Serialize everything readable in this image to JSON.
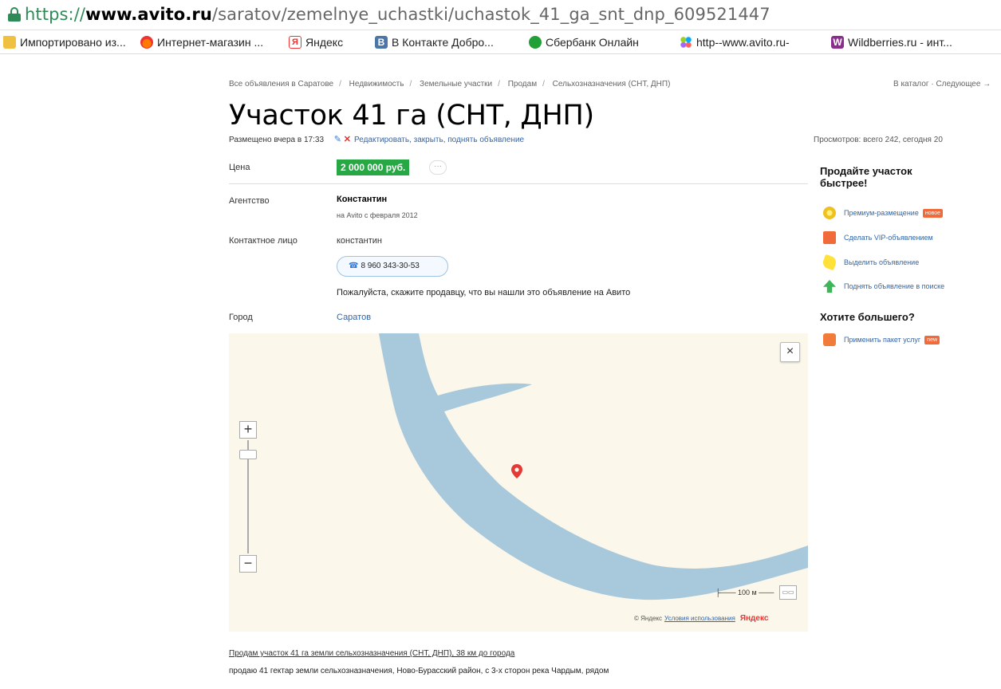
{
  "browser": {
    "url_scheme": "https://",
    "url_host": "www.avito.ru",
    "url_path": "/saratov/zemelnye_uchastki/uchastok_41_ga_snt_dnp_609521447",
    "bookmarks": [
      {
        "label": "Импортировано из...",
        "icon": "folder-icon"
      },
      {
        "label": "Интернет-магазин ...",
        "icon": "fire-icon"
      },
      {
        "label": "Яндекс",
        "icon": "yandex-icon"
      },
      {
        "label": "В Контакте  Добро...",
        "icon": "vk-icon"
      },
      {
        "label": "Сбербанк Онлайн",
        "icon": "sber-icon"
      },
      {
        "label": "http--www.avito.ru-",
        "icon": "avito-icon"
      },
      {
        "label": "Wildberries.ru - инт...",
        "icon": "wb-icon"
      }
    ],
    "icon_texts": {
      "yandex": "Я",
      "vk": "B",
      "wb": "W"
    }
  },
  "breadcrumbs": [
    "Все объявления в Саратове",
    "Недвижимость",
    "Земельные участки",
    "Продам",
    "Сельхозназначения (СНТ, ДНП)"
  ],
  "catalog_nav": "В каталог · Следующее →",
  "listing": {
    "title": "Участок 41 га (СНТ, ДНП)",
    "posted": "Размещено вчера в 17:33",
    "edit_links": "Редактировать, закрыть, поднять объявление",
    "views": "Просмотров: всего 242, сегодня 20",
    "price_label": "Цена",
    "price": "2 000 000 руб.",
    "price_more": "···",
    "agency_label": "Агентство",
    "agency_name": "Константин",
    "agency_since": "на Avito с февраля 2012",
    "contact_label": "Контактное лицо",
    "contact_name": "константин",
    "phone": "8 960 343-30-53",
    "please_note": "Пожалуйста, скажите продавцу, что вы нашли это объявление на Авито",
    "city_label": "Город",
    "city": "Саратов"
  },
  "map": {
    "close": "×",
    "zoom_in": "+",
    "zoom_out": "−",
    "scale": "100 м",
    "ruler": "▭▭",
    "copyright": "© Яндекс",
    "terms": "Условия использования",
    "logo": "Яндекс",
    "colors": {
      "water": "#a8c9dc",
      "land": "#fbf7ea",
      "pin": "#e53935"
    }
  },
  "description": {
    "title": "Продам участок 41 га земли сельхозназначения (СНТ, ДНП), 38 км до города",
    "text": "продаю 41 гектар земли сельхозназначения, Ново-Бурасский район, с 3-х сторон река Чардым, рядом"
  },
  "sidebar": {
    "sell_heading_line1": "Продайте участок",
    "sell_heading_line2": "быстрее!",
    "services": [
      {
        "label": "Премиум-размещение",
        "badge": "новое",
        "icon": "premium-icon"
      },
      {
        "label": "Сделать VIP-объявлением",
        "badge": "",
        "icon": "vip-icon"
      },
      {
        "label": "Выделить объявление",
        "badge": "",
        "icon": "highlight-icon"
      },
      {
        "label": "Поднять объявление в поиске",
        "badge": "",
        "icon": "up-arrow-icon"
      }
    ],
    "more_heading": "Хотите большего?",
    "package": {
      "label": "Применить пакет услуг",
      "badge": "new",
      "icon": "package-icon"
    }
  }
}
